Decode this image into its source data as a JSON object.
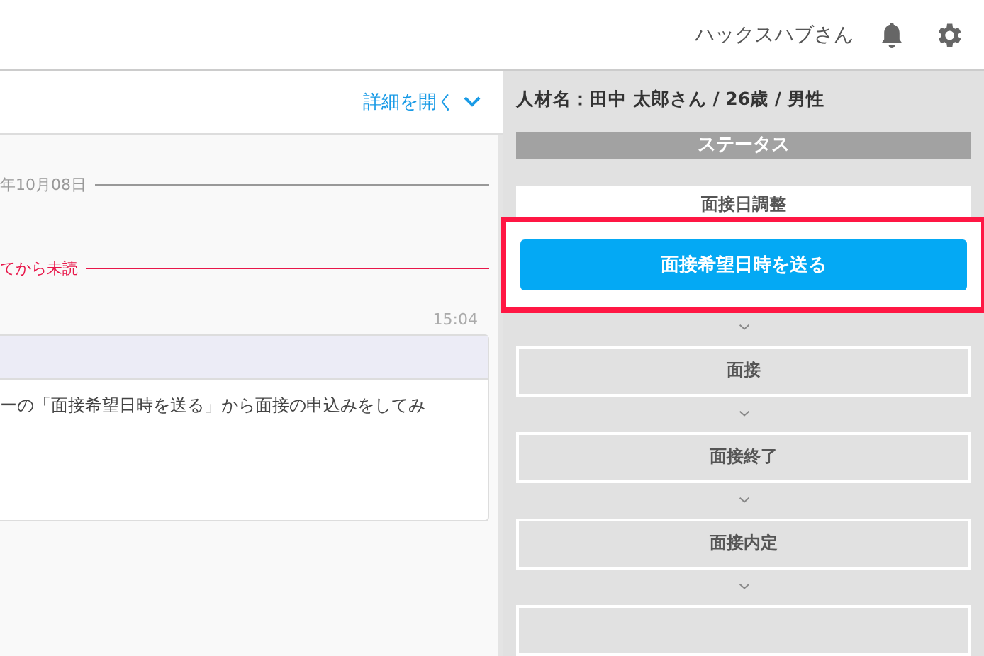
{
  "header": {
    "user_name": "ハックスハブさん"
  },
  "detail_link": {
    "label": "詳細を開く"
  },
  "chat": {
    "date_divider": "年10月08日",
    "unread_divider": "てから未読",
    "messages": [
      {
        "time": "15:04",
        "body": "ーの「面接希望日時を送る」から面接の申込みをしてみ"
      }
    ]
  },
  "candidate": {
    "info": "人材名：田中 太郎さん / 26歳 / 男性"
  },
  "status": {
    "title": "ステータス",
    "stages": [
      {
        "label": "面接日調整",
        "current": true,
        "action": "面接希望日時を送る",
        "highlighted": true
      },
      {
        "label": "面接",
        "current": false
      },
      {
        "label": "面接終了",
        "current": false
      },
      {
        "label": "面接内定",
        "current": false
      },
      {
        "current": false
      }
    ]
  }
}
